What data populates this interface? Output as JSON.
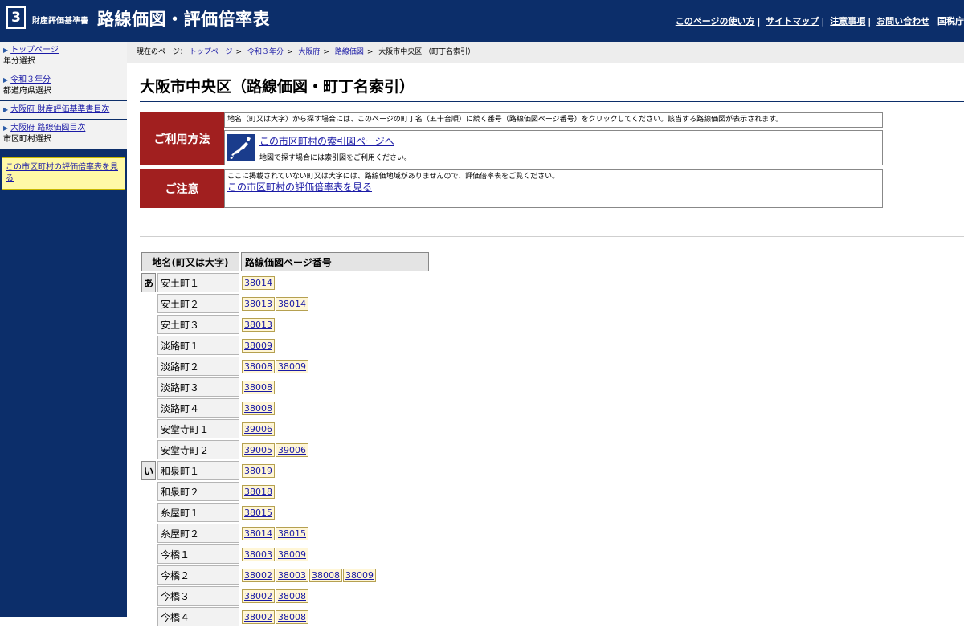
{
  "header": {
    "logo_number": "3",
    "brand_small": "財産評価基準書",
    "brand_big": "路線価図・評価倍率表",
    "nav": [
      "このページの使い方",
      "サイトマップ",
      "注意事項",
      "お問い合わせ"
    ],
    "site": "国税庁"
  },
  "sidebar": {
    "items": [
      {
        "link": "トップページ",
        "sub": "年分選択"
      },
      {
        "link": "令和３年分",
        "sub": "都道府県選択"
      },
      {
        "link": "大阪府 財産評価基準書目次",
        "sub": ""
      },
      {
        "link": "大阪府 路線価図目次",
        "sub": "市区町村選択"
      }
    ],
    "yellow_link": "この市区町村の評価倍率表を見る"
  },
  "breadcrumb": {
    "prefix": "現在のページ：",
    "links": [
      "トップページ",
      "令和３年分",
      "大阪府",
      "路線価図"
    ],
    "current": "大阪市中央区 （町丁名索引）"
  },
  "page_title": "大阪市中央区（路線価図・町丁名索引）",
  "notice": {
    "usage_label": "ご利用方法",
    "usage_text": "地名（町又は大字）から探す場合には、このページの町丁名（五十音順）に続く番号（路線価図ページ番号）をクリックしてください。該当する路線価図が表示されます。",
    "map_link": "この市区町村の索引図ページへ",
    "map_sub": "地図で探す場合には索引図をご利用ください。",
    "caution_label": "ご注意",
    "caution_text": "ここに掲載されていない町又は大字には、路線価地域がありませんので、評価倍率表をご覧ください。",
    "caution_link": "この市区町村の評価倍率表を見る"
  },
  "table": {
    "headers": [
      "地名(町又は大字)",
      "路線価図ページ番号"
    ],
    "rows": [
      {
        "kana": "あ",
        "name": "安土町１",
        "pages": [
          "38014"
        ]
      },
      {
        "kana": "",
        "name": "安土町２",
        "pages": [
          "38013",
          "38014"
        ]
      },
      {
        "kana": "",
        "name": "安土町３",
        "pages": [
          "38013"
        ]
      },
      {
        "kana": "",
        "name": "淡路町１",
        "pages": [
          "38009"
        ]
      },
      {
        "kana": "",
        "name": "淡路町２",
        "pages": [
          "38008",
          "38009"
        ]
      },
      {
        "kana": "",
        "name": "淡路町３",
        "pages": [
          "38008"
        ]
      },
      {
        "kana": "",
        "name": "淡路町４",
        "pages": [
          "38008"
        ]
      },
      {
        "kana": "",
        "name": "安堂寺町１",
        "pages": [
          "39006"
        ]
      },
      {
        "kana": "",
        "name": "安堂寺町２",
        "pages": [
          "39005",
          "39006"
        ]
      },
      {
        "kana": "い",
        "name": "和泉町１",
        "pages": [
          "38019"
        ]
      },
      {
        "kana": "",
        "name": "和泉町２",
        "pages": [
          "38018"
        ]
      },
      {
        "kana": "",
        "name": "糸屋町１",
        "pages": [
          "38015"
        ]
      },
      {
        "kana": "",
        "name": "糸屋町２",
        "pages": [
          "38014",
          "38015"
        ]
      },
      {
        "kana": "",
        "name": "今橋１",
        "pages": [
          "38003",
          "38009"
        ]
      },
      {
        "kana": "",
        "name": "今橋２",
        "pages": [
          "38002",
          "38003",
          "38008",
          "38009"
        ]
      },
      {
        "kana": "",
        "name": "今橋３",
        "pages": [
          "38002",
          "38008"
        ]
      },
      {
        "kana": "",
        "name": "今橋４",
        "pages": [
          "38002",
          "38008"
        ]
      }
    ]
  }
}
